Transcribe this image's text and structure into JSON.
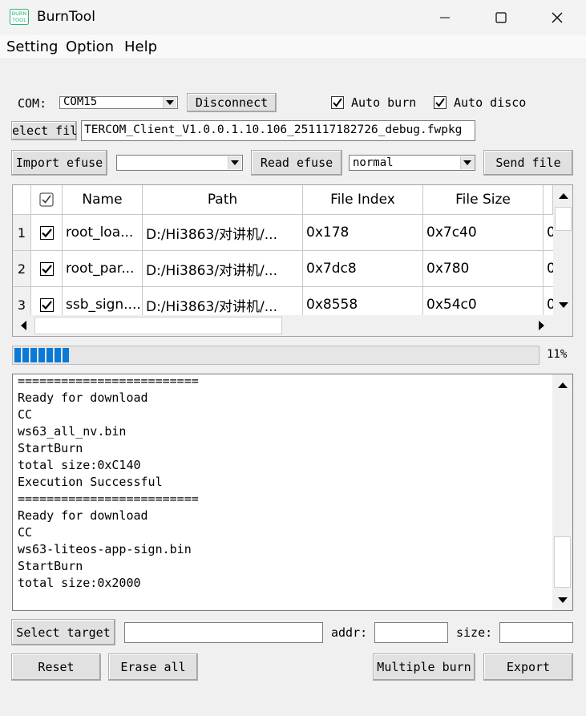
{
  "window": {
    "app_icon_text": "BURN\nTOOL",
    "title": "BurnTool",
    "minimize_glyph": "—",
    "maximize_glyph": "☐",
    "close_glyph": "✕"
  },
  "menu": [
    "Setting",
    "Option",
    "Help"
  ],
  "com": {
    "label": "COM:",
    "port": "COM15",
    "connect_button": "Disconnect",
    "auto_burn_label": "Auto burn",
    "auto_burn_checked": true,
    "auto_disconnect_label": "Auto disco",
    "auto_disconnect_checked": true
  },
  "file": {
    "select_button": "elect fil",
    "path": "TERCOM_Client_V1.0.0.1.10.106_251117182726_debug.fwpkg"
  },
  "efuse": {
    "import_button": "Import efuse",
    "select_value": "",
    "read_button": "Read efuse",
    "mode_value": "normal",
    "send_button": "Send file"
  },
  "grid": {
    "columns": [
      "",
      "Name",
      "Path",
      "File Index",
      "File Size",
      ""
    ],
    "rows": [
      {
        "num": "1",
        "checked": true,
        "name": "root_loa...",
        "path": "D:/Hi3863/对讲机/...",
        "index": "0x178",
        "size": "0x7c40",
        "extra": "0"
      },
      {
        "num": "2",
        "checked": true,
        "name": "root_par...",
        "path": "D:/Hi3863/对讲机/...",
        "index": "0x7dc8",
        "size": "0x780",
        "extra": "0"
      },
      {
        "num": "3",
        "checked": true,
        "name": "ssb_sign....",
        "path": "D:/Hi3863/对讲机/...",
        "index": "0x8558",
        "size": "0x54c0",
        "extra": "0"
      }
    ]
  },
  "progress": {
    "value": 0.11,
    "label": "11%",
    "color": "#0a7ad6"
  },
  "log": {
    "lines": [
      "=========================",
      "Ready for download",
      "CC",
      "ws63_all_nv.bin",
      "StartBurn",
      "total size:0xC140",
      "Execution Successful",
      "=========================",
      "Ready for download",
      "CC",
      "ws63-liteos-app-sign.bin",
      "StartBurn",
      "total size:0x2000"
    ]
  },
  "target": {
    "select_button": "Select target",
    "target_value": "",
    "addr_label": "addr:",
    "addr_value": "",
    "size_label": "size:",
    "size_value": ""
  },
  "actions": {
    "reset": "Reset",
    "erase_all": "Erase all",
    "multiple_burn": "Multiple burn",
    "export": "Export"
  }
}
